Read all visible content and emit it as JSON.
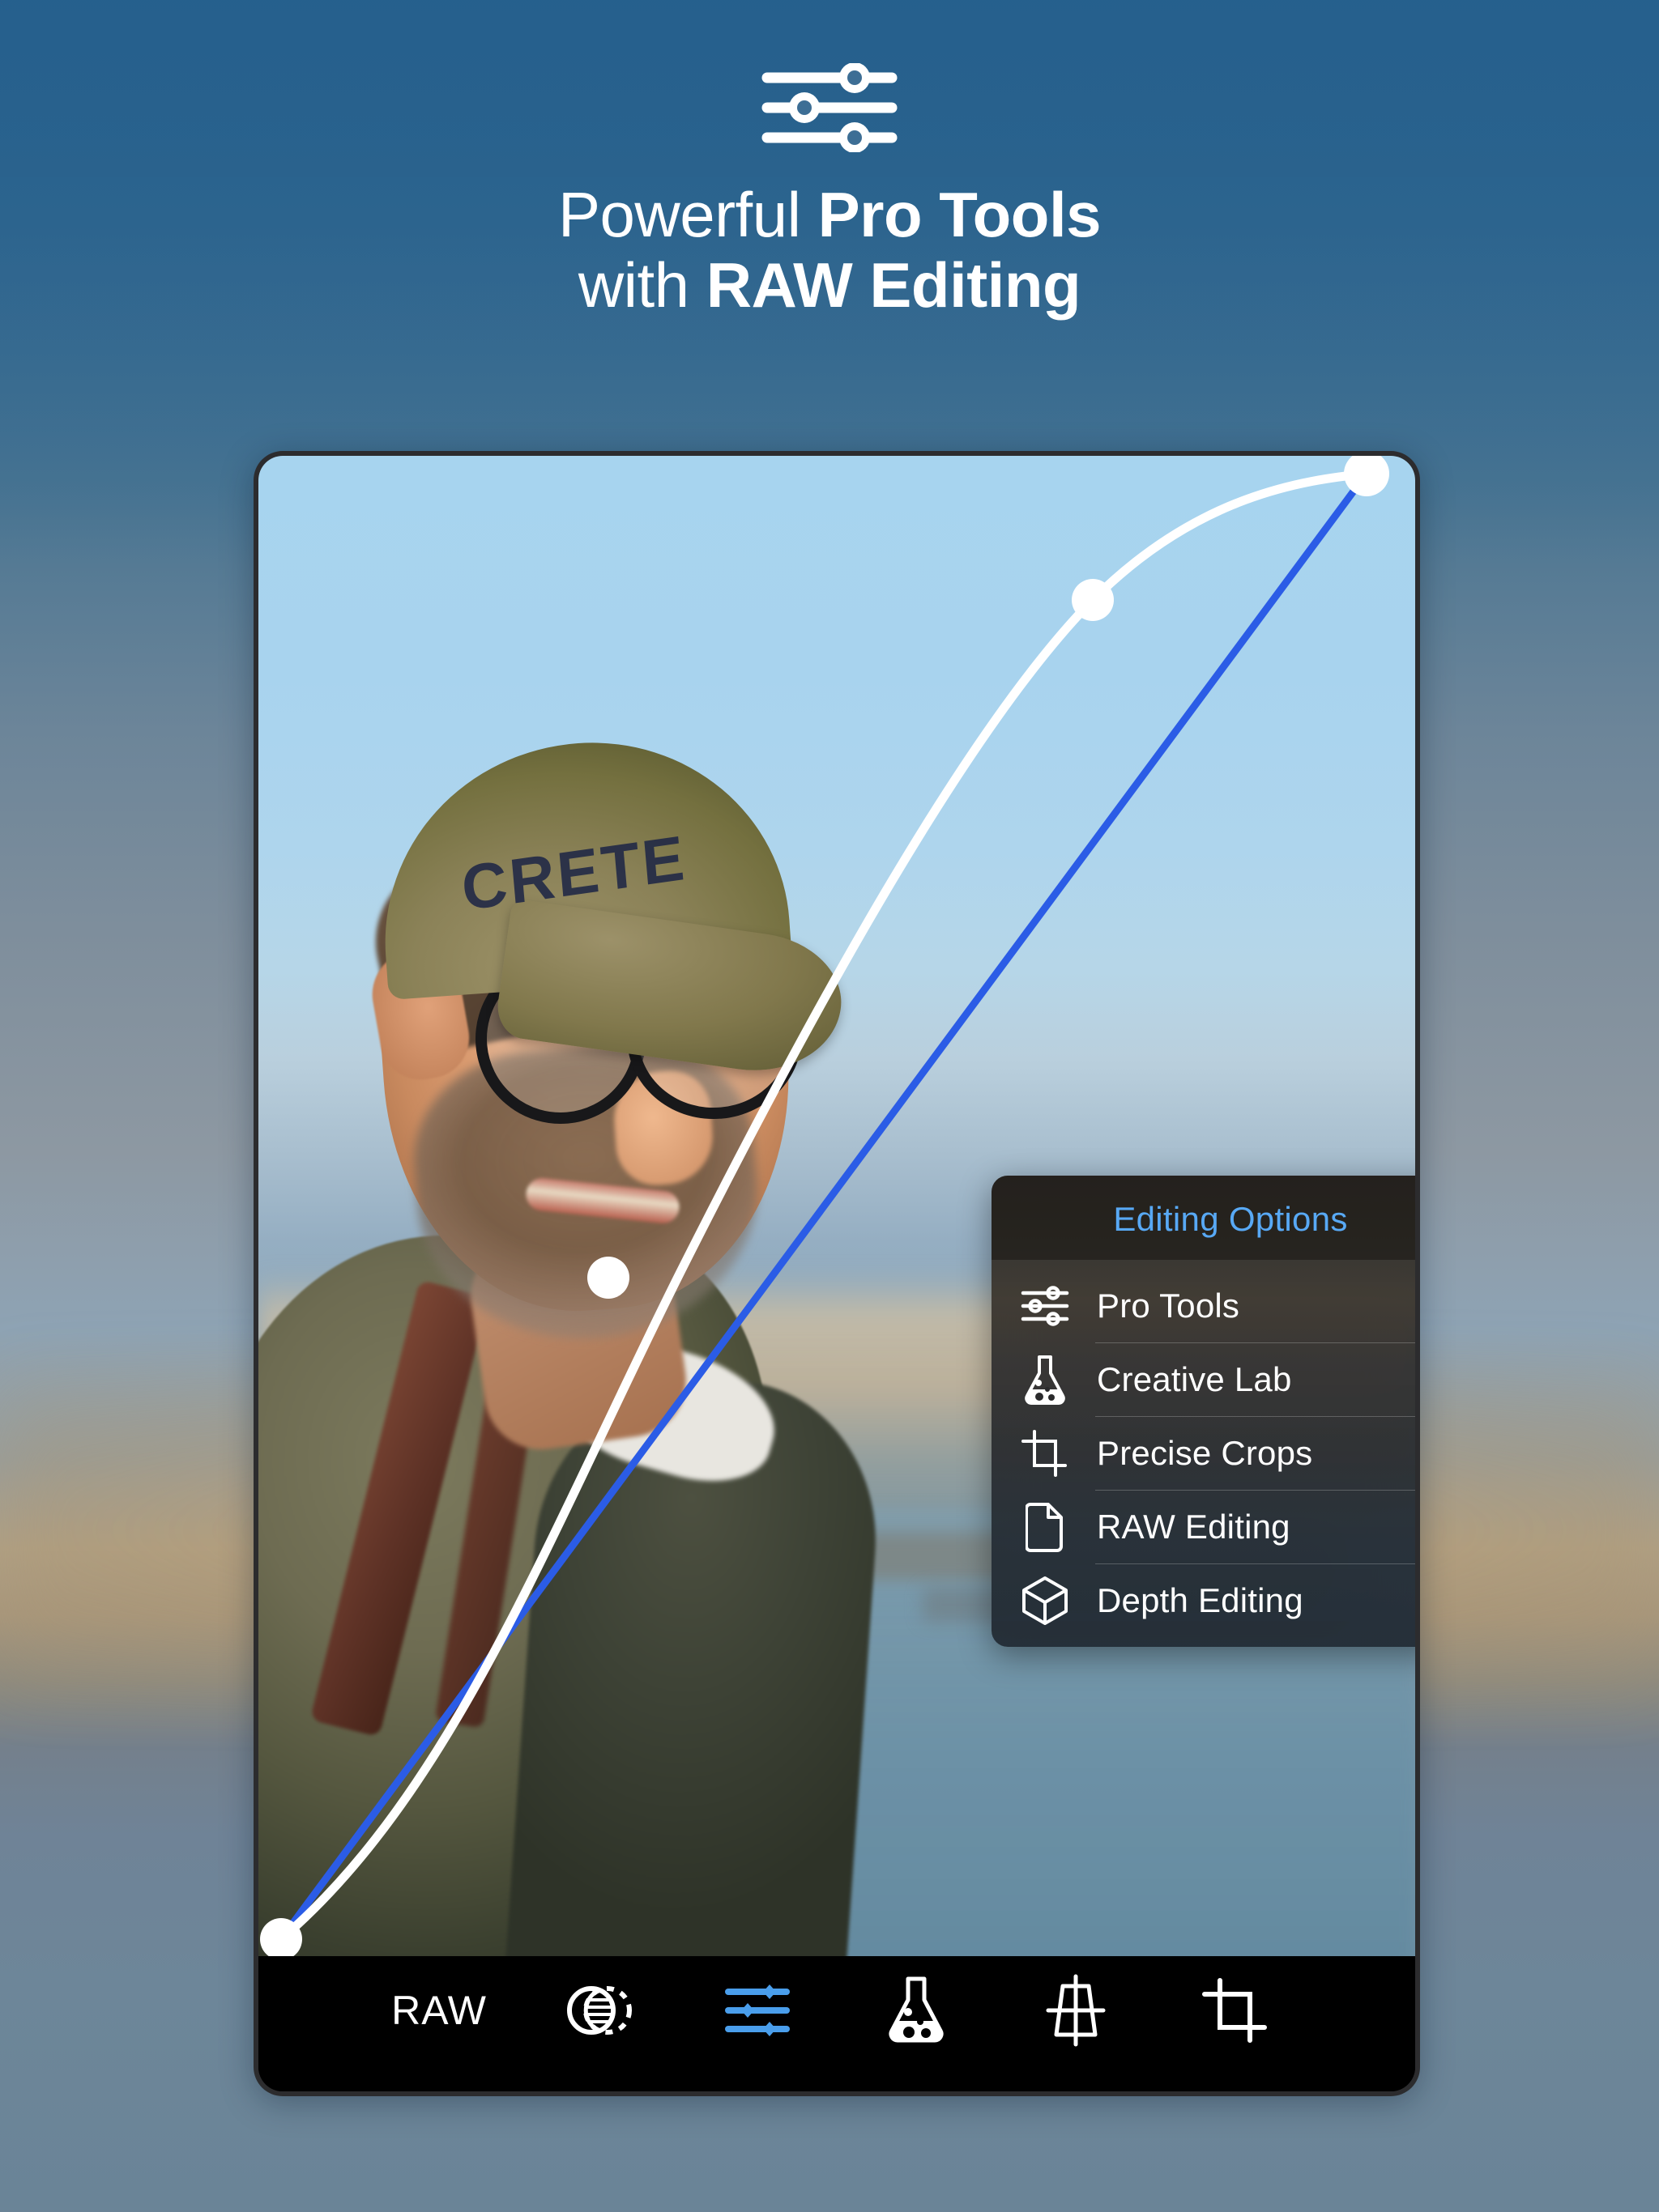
{
  "header": {
    "icon": "sliders-icon",
    "headline_line1_light": "Powerful ",
    "headline_line1_bold": "Pro Tools",
    "headline_line2_light": "with ",
    "headline_line2_bold": "RAW Editing"
  },
  "photo": {
    "cap_text": "CRETE",
    "description": "man-with-cap-and-glasses-portrait"
  },
  "curve": {
    "tool": "tone-curve",
    "reference_line_color": "#2b5ce6",
    "curve_color": "#ffffff",
    "control_points": [
      {
        "name": "shadows-point",
        "x": 0.02,
        "y": 0.98
      },
      {
        "name": "midtones-point",
        "x": 0.3,
        "y": 0.54
      },
      {
        "name": "highlights-point",
        "x": 0.72,
        "y": 0.095
      },
      {
        "name": "whites-point",
        "x": 0.955,
        "y": 0.012
      }
    ]
  },
  "panel": {
    "title": "Editing Options",
    "title_color": "#58a9f5",
    "items": [
      {
        "label": "Pro Tools",
        "icon": "sliders-icon"
      },
      {
        "label": "Creative Lab",
        "icon": "flask-icon"
      },
      {
        "label": "Precise Crops",
        "icon": "crop-icon"
      },
      {
        "label": "RAW Editing",
        "icon": "document-icon"
      },
      {
        "label": "Depth Editing",
        "icon": "cube-icon"
      }
    ]
  },
  "toolbar": {
    "active_color": "#4a9eeb",
    "items": [
      {
        "name": "raw-button",
        "label": "RAW",
        "icon": "raw-text",
        "active": false
      },
      {
        "name": "selective-button",
        "label": "",
        "icon": "selective-icon",
        "active": false
      },
      {
        "name": "protools-button",
        "label": "",
        "icon": "sliders-icon",
        "active": true
      },
      {
        "name": "lab-button",
        "label": "",
        "icon": "flask-icon",
        "active": false
      },
      {
        "name": "perspective-button",
        "label": "",
        "icon": "perspective-icon",
        "active": false
      },
      {
        "name": "crop-button",
        "label": "",
        "icon": "crop-icon",
        "active": false
      }
    ]
  },
  "colors": {
    "background_top": "#2c6290",
    "background_bottom": "#6a8497",
    "device_frame": "#2c2c2e",
    "accent_blue": "#58a9f5"
  }
}
